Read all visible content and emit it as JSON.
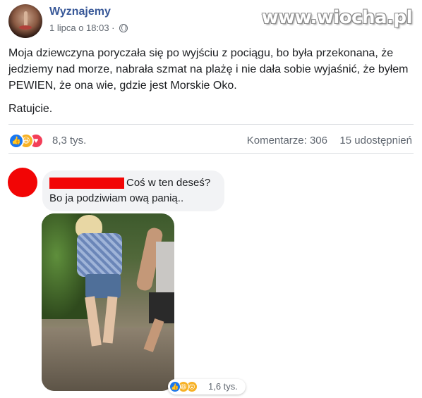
{
  "post": {
    "page_name": "Wyznajemy",
    "date": "1 lipca o 18:03 ·",
    "privacy_icon": "globe-icon",
    "watermark": "www.wiocha.pl",
    "paragraph1": "Moja dziewczyna poryczała się po wyjściu z pociągu, bo była przekonana, że jedziemy nad morze, nabrała szmat na plażę i nie dała sobie wyjaśnić, że byłem PEWIEN, że ona wie, gdzie jest Morskie Oko.",
    "paragraph2": "Ratujcie.",
    "reactions": {
      "icons": [
        "like-icon",
        "haha-icon",
        "love-icon"
      ],
      "count": "8,3 tys."
    },
    "comments_count": "Komentarze: 306",
    "shares_count": "15 udostępnień"
  },
  "comment": {
    "line1": "Coś w ten deseś?",
    "line2": "Bo ja podziwiam ową panią..",
    "photo_reactions": {
      "icons": [
        "like-icon",
        "haha-icon",
        "wow-icon"
      ],
      "count": "1,6 tys."
    }
  },
  "colors": {
    "name_link": "#385898",
    "redaction": "#f20505",
    "like": "#1877f2",
    "love": "#f33e58",
    "haha": "#f7b125"
  }
}
